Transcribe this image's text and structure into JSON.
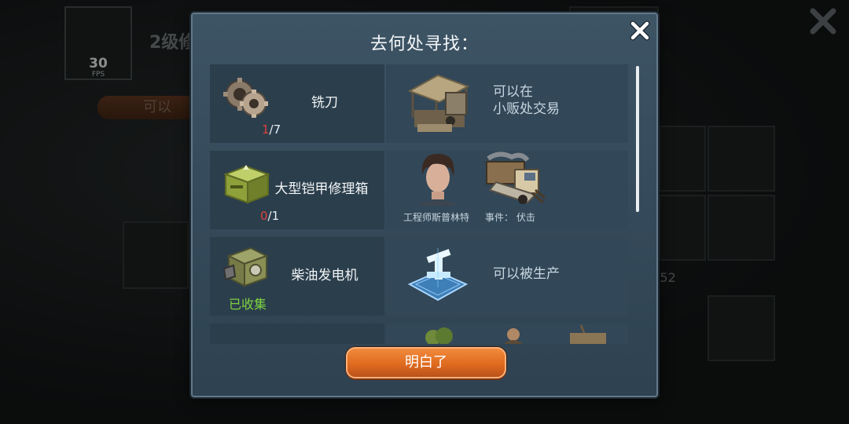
{
  "hud": {
    "fps_value": "30",
    "fps_label": "FPS"
  },
  "background": {
    "title": "2级修",
    "pill": "可以",
    "count": "/52"
  },
  "dialog": {
    "title": "去何处寻找：",
    "confirm_label": "明白了",
    "close_icon": "close-icon"
  },
  "items": [
    {
      "name": "铣刀",
      "icon": "gears-icon",
      "count_current": "1",
      "count_total": "/7",
      "source_text_line1": "可以在",
      "source_text_line2": "小贩处交易",
      "source_icon": "vendor-stall-icon"
    },
    {
      "name": "大型铠甲修理箱",
      "icon": "repair-box-icon",
      "count_current": "0",
      "count_total": "/1",
      "source_npc_caption": "工程师斯普林特",
      "source_event_caption": "事件： 伏击",
      "source_icons": [
        "engineer-portrait-icon",
        "ambush-truck-icon"
      ]
    },
    {
      "name": "柴油发电机",
      "icon": "generator-icon",
      "status": "已收集",
      "source_text": "可以被生产",
      "source_icon": "blueprint-icon"
    }
  ],
  "colors": {
    "accent": "#e06b1f",
    "deficit": "#e0413c",
    "collected": "#7ed340",
    "panel": "#344959"
  }
}
